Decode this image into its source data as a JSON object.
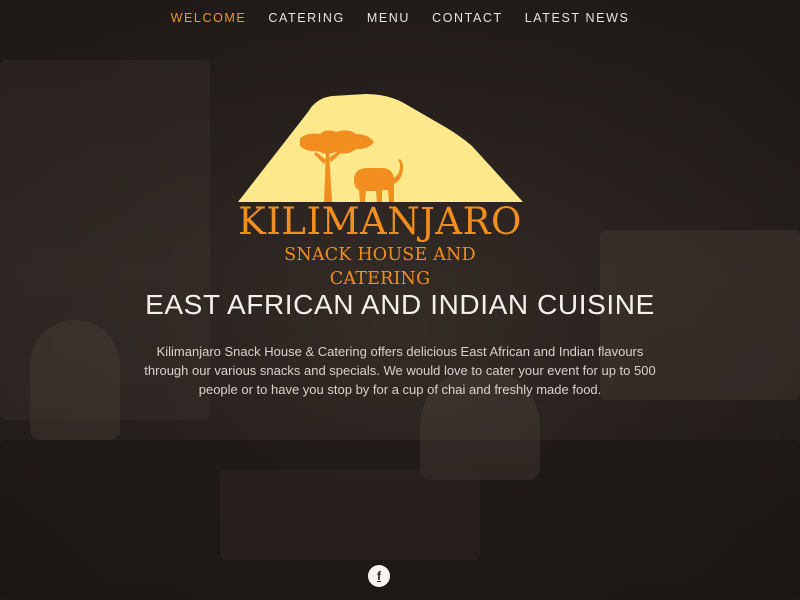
{
  "nav": {
    "items": [
      {
        "label": "WELCOME",
        "active": true
      },
      {
        "label": "CATERING",
        "active": false
      },
      {
        "label": "MENU",
        "active": false
      },
      {
        "label": "CONTACT",
        "active": false
      },
      {
        "label": "LATEST NEWS",
        "active": false
      }
    ]
  },
  "logo": {
    "name": "KILIMANJARO",
    "subtitle": "SNACK HOUSE AND CATERING",
    "colors": {
      "mountain": "#fde98c",
      "accent": "#f18e1f"
    },
    "icons": [
      "mountain-icon",
      "acacia-tree-icon",
      "elephant-icon"
    ]
  },
  "hero": {
    "headline": "EAST AFRICAN AND INDIAN CUISINE",
    "intro": "Kilimanjaro Snack House & Catering offers delicious East African and Indian flavours through our various snacks and specials. We would love to cater your event for up to 500 people or to have you stop by for a cup of chai and freshly made food."
  },
  "social": {
    "facebook_glyph": "f",
    "icon": "facebook-icon"
  },
  "colors": {
    "nav_active": "#f0962a",
    "nav_text": "#e9e4de",
    "background": "#2a2220"
  }
}
